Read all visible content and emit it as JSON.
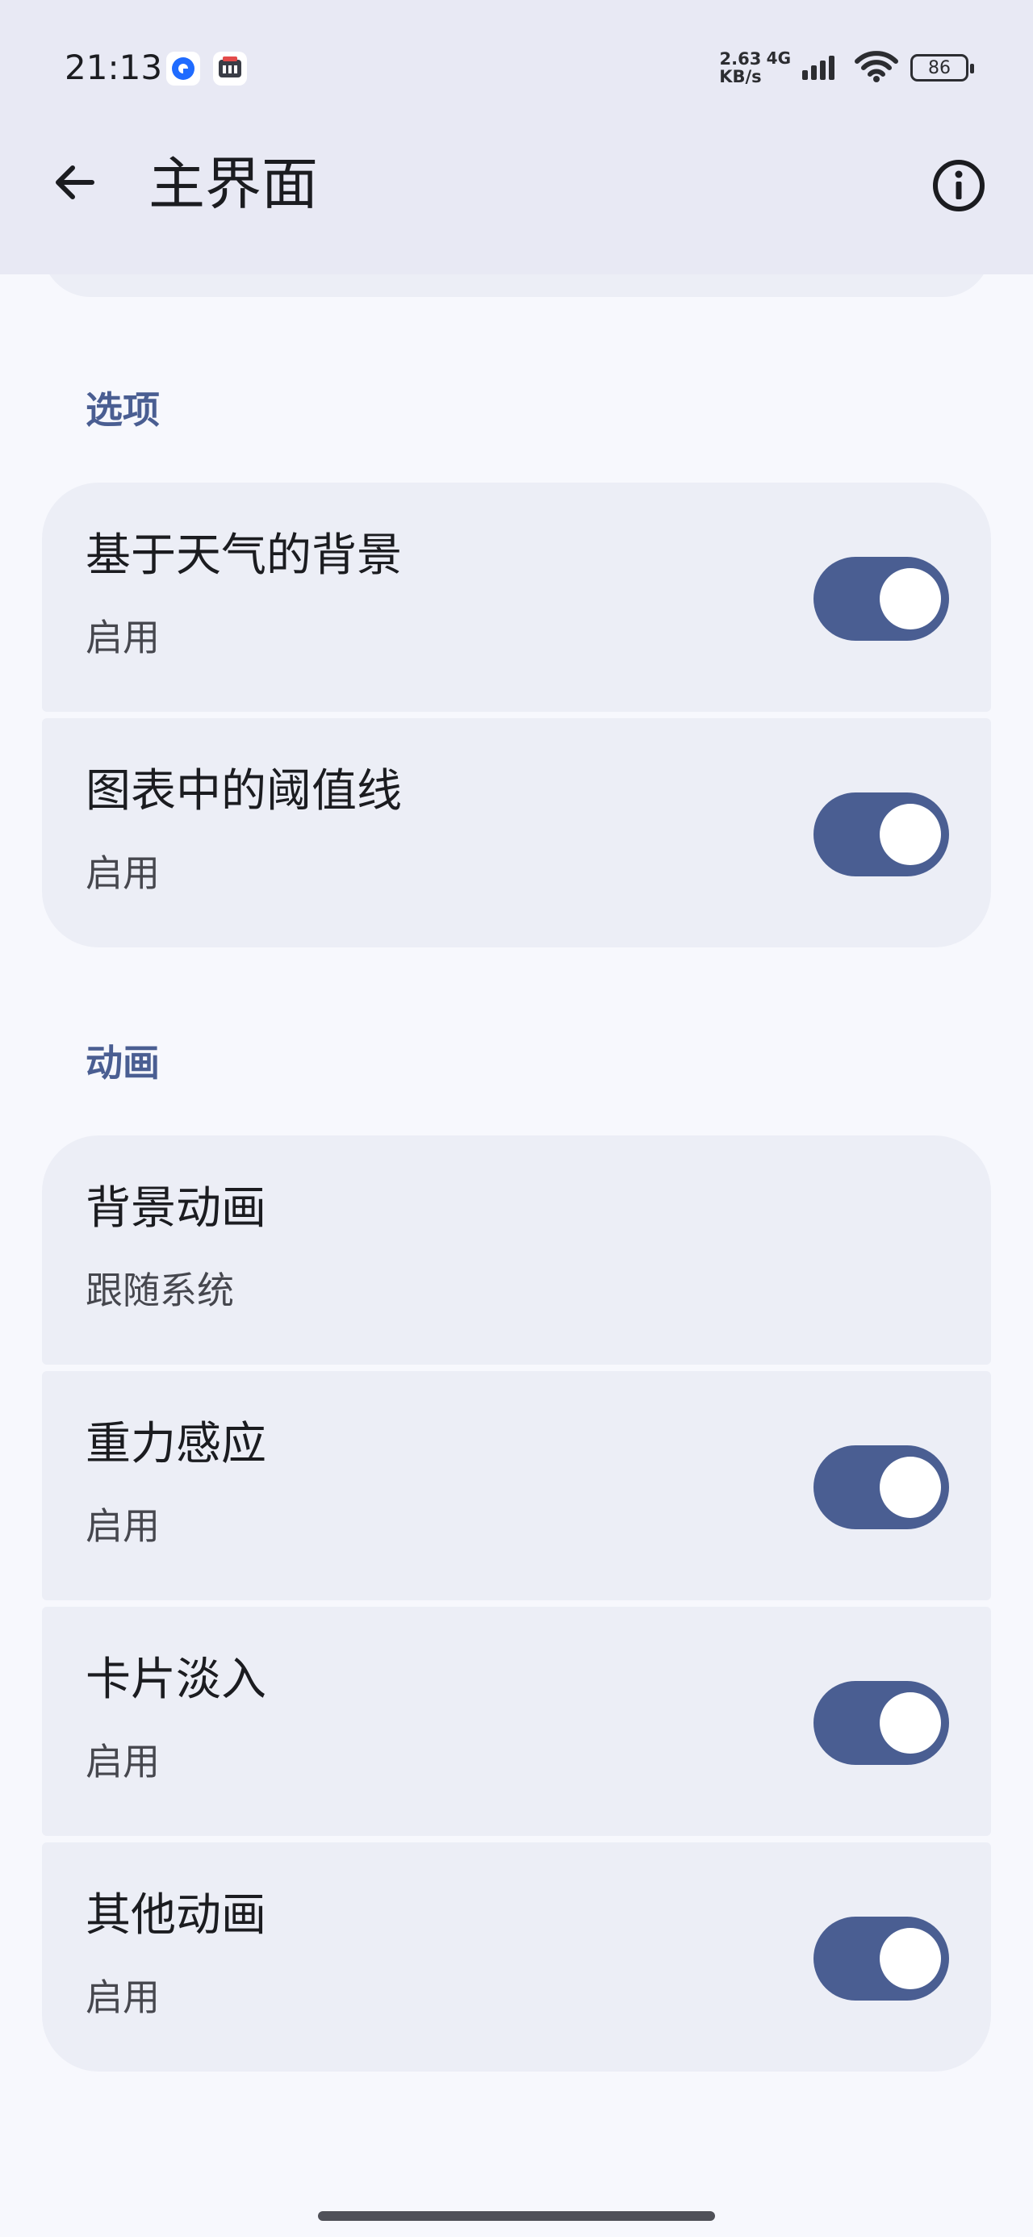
{
  "status_bar": {
    "time": "21:13",
    "net_speed_value": "2.63",
    "net_speed_unit": "KB/s",
    "network_type": "4G",
    "battery_level": "86"
  },
  "app_bar": {
    "title": "主界面",
    "back_icon": "arrow-left-icon",
    "info_icon": "info-icon"
  },
  "sections": [
    {
      "header": "选项",
      "items": [
        {
          "title": "基于天气的背景",
          "subtitle": "启用",
          "toggle": true
        },
        {
          "title": "图表中的阈值线",
          "subtitle": "启用",
          "toggle": true
        }
      ]
    },
    {
      "header": "动画",
      "items": [
        {
          "title": "背景动画",
          "subtitle": "跟随系统"
        },
        {
          "title": "重力感应",
          "subtitle": "启用",
          "toggle": true
        },
        {
          "title": "卡片淡入",
          "subtitle": "启用",
          "toggle": true
        },
        {
          "title": "其他动画",
          "subtitle": "启用",
          "toggle": true
        }
      ]
    }
  ],
  "colors": {
    "accent": "#4a5e92",
    "app_bar_bg": "#e8e9f4",
    "card_bg": "#eceef6",
    "page_bg": "#f7f8fd"
  }
}
